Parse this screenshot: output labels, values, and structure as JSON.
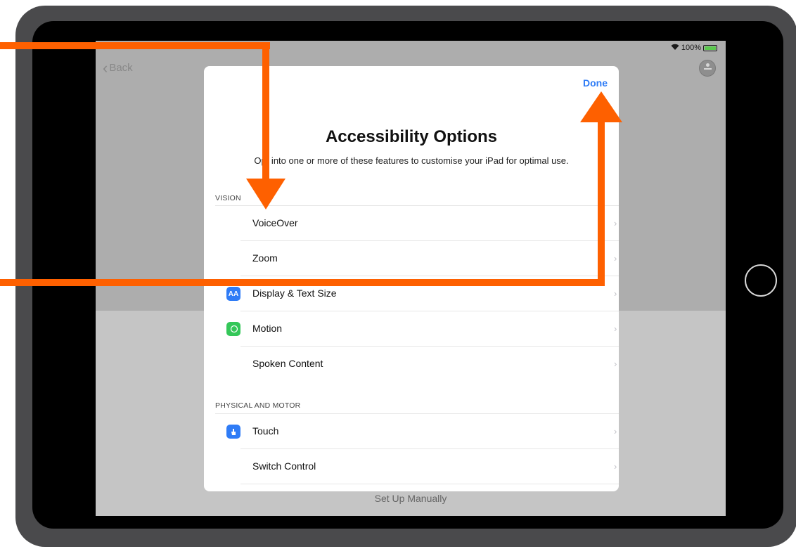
{
  "status": {
    "battery": "100%"
  },
  "nav": {
    "back_label": "Back"
  },
  "modal": {
    "done_label": "Done",
    "title": "Accessibility Options",
    "subtitle": "Opt into one or more of these features to customise your iPad for optimal use.",
    "sections": [
      {
        "header": "VISION",
        "items": [
          {
            "label": "VoiceOver",
            "icon": "voiceover-icon",
            "color": "#3a3a3c"
          },
          {
            "label": "Zoom",
            "icon": "zoom-icon",
            "color": "#3a3a3c"
          },
          {
            "label": "Display & Text Size",
            "icon": "display-text-size-icon",
            "color": "#2f7cf6",
            "glyph": "AA"
          },
          {
            "label": "Motion",
            "icon": "motion-icon",
            "color": "#34c759"
          },
          {
            "label": "Spoken Content",
            "icon": "spoken-content-icon",
            "color": "#3a3a3c"
          }
        ]
      },
      {
        "header": "PHYSICAL AND MOTOR",
        "items": [
          {
            "label": "Touch",
            "icon": "touch-icon",
            "color": "#2f7cf6"
          },
          {
            "label": "Switch Control",
            "icon": "switch-control-icon",
            "color": "#3a3a3c"
          }
        ]
      }
    ]
  },
  "footer": {
    "setup_manually": "Set Up Manually"
  },
  "annotation_color": "#fe6000"
}
